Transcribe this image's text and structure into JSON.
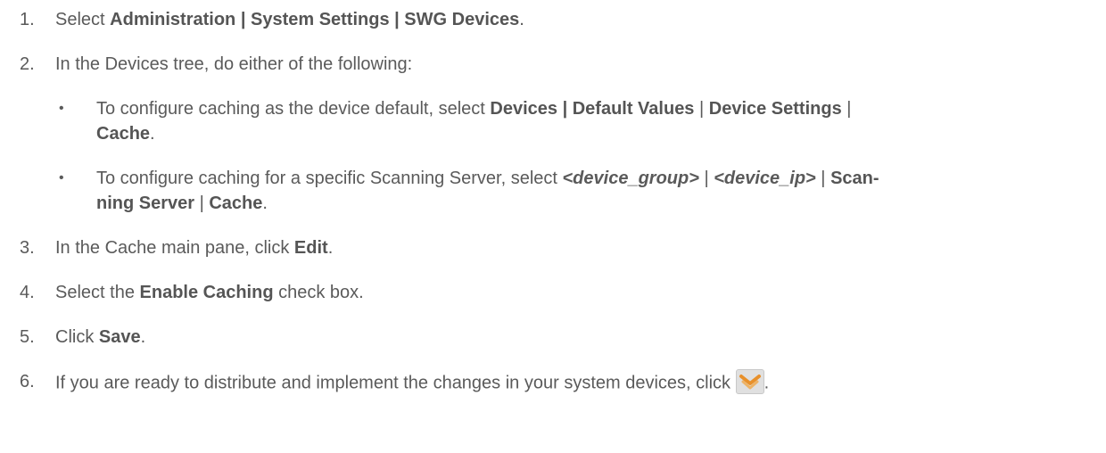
{
  "steps": [
    {
      "num": "1.",
      "prefix": "Select ",
      "path": "Administration | System Settings | SWG Devices",
      "suffix": "."
    },
    {
      "num": "2.",
      "text": "In the Devices tree, do either of the following:",
      "bullets": [
        {
          "bullet": "•",
          "prefix": "To configure caching as the device default, select ",
          "p1": "Devices | Default Values",
          "sep1": " | ",
          "p2": "Device Settings",
          "sep2": " |",
          "p3": "Cache",
          "suffix": "."
        },
        {
          "bullet": "•",
          "prefix": "To configure caching for a specific Scanning Server, select ",
          "p1": "<device_group>",
          "sep1": " | ",
          "p2": "<device_ip>",
          "sep2": " | ",
          "p3a": "Scan-",
          "p3b": "ning Server",
          "sep3": " | ",
          "p4": "Cache",
          "suffix": "."
        }
      ]
    },
    {
      "num": "3.",
      "prefix": "In the Cache main pane, click ",
      "bold": "Edit",
      "suffix": "."
    },
    {
      "num": "4.",
      "prefix": "Select the ",
      "bold": "Enable Caching",
      "suffix": " check box."
    },
    {
      "num": "5.",
      "prefix": "Click ",
      "bold": "Save",
      "suffix": "."
    },
    {
      "num": "6.",
      "prefix": "If you are ready to distribute and implement the changes in your system devices, click ",
      "icon": "distribute-changes-icon",
      "suffix": "."
    }
  ],
  "colors": {
    "text": "#5a5a5a",
    "icon_orange": "#e8902a",
    "icon_bg": "#e0e0e0"
  }
}
